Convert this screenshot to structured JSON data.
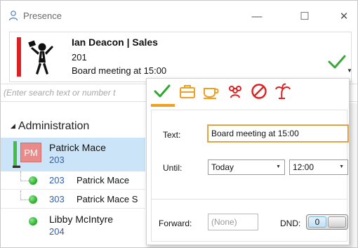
{
  "window": {
    "title": "Presence",
    "minimize_label": "—",
    "maximize_label": "☐",
    "close_label": "✕"
  },
  "header": {
    "name": "Ian Deacon | Sales",
    "extension": "201",
    "status_text": "Board meeting at 15:00",
    "status_icon": "check-icon",
    "accent_color": "#e02020"
  },
  "search": {
    "placeholder": "(Enter search text or number t"
  },
  "directory": {
    "group": "Administration",
    "selected_contact": {
      "initials": "PM",
      "name": "Patrick Mace",
      "extension": "203"
    },
    "sub_entries": [
      {
        "extension": "203",
        "name": "Patrick Mace"
      },
      {
        "extension": "303",
        "name": "Patrick Mace S"
      }
    ],
    "contact": {
      "name": "Libby McIntyre",
      "extension": "204"
    }
  },
  "popup": {
    "status_icons": [
      "available-check-icon",
      "briefcase-icon",
      "coffee-cup-icon",
      "meeting-people-icon",
      "do-not-disturb-icon",
      "palm-tree-icon"
    ],
    "selected_status": "available-check-icon",
    "text_label": "Text:",
    "text_value": "Board meeting at 15:00",
    "until_label": "Until:",
    "until_day": "Today",
    "until_time": "12:00",
    "forward_label": "Forward:",
    "forward_value": "(None)",
    "dnd_label": "DND:",
    "dnd_value": "0"
  },
  "colors": {
    "selection_bg": "#cce4f7",
    "presence_green": "#3ec13e",
    "link_blue": "#3060b0",
    "popup_icon_orange": "#f0a020",
    "popup_icon_red": "#e02020"
  }
}
